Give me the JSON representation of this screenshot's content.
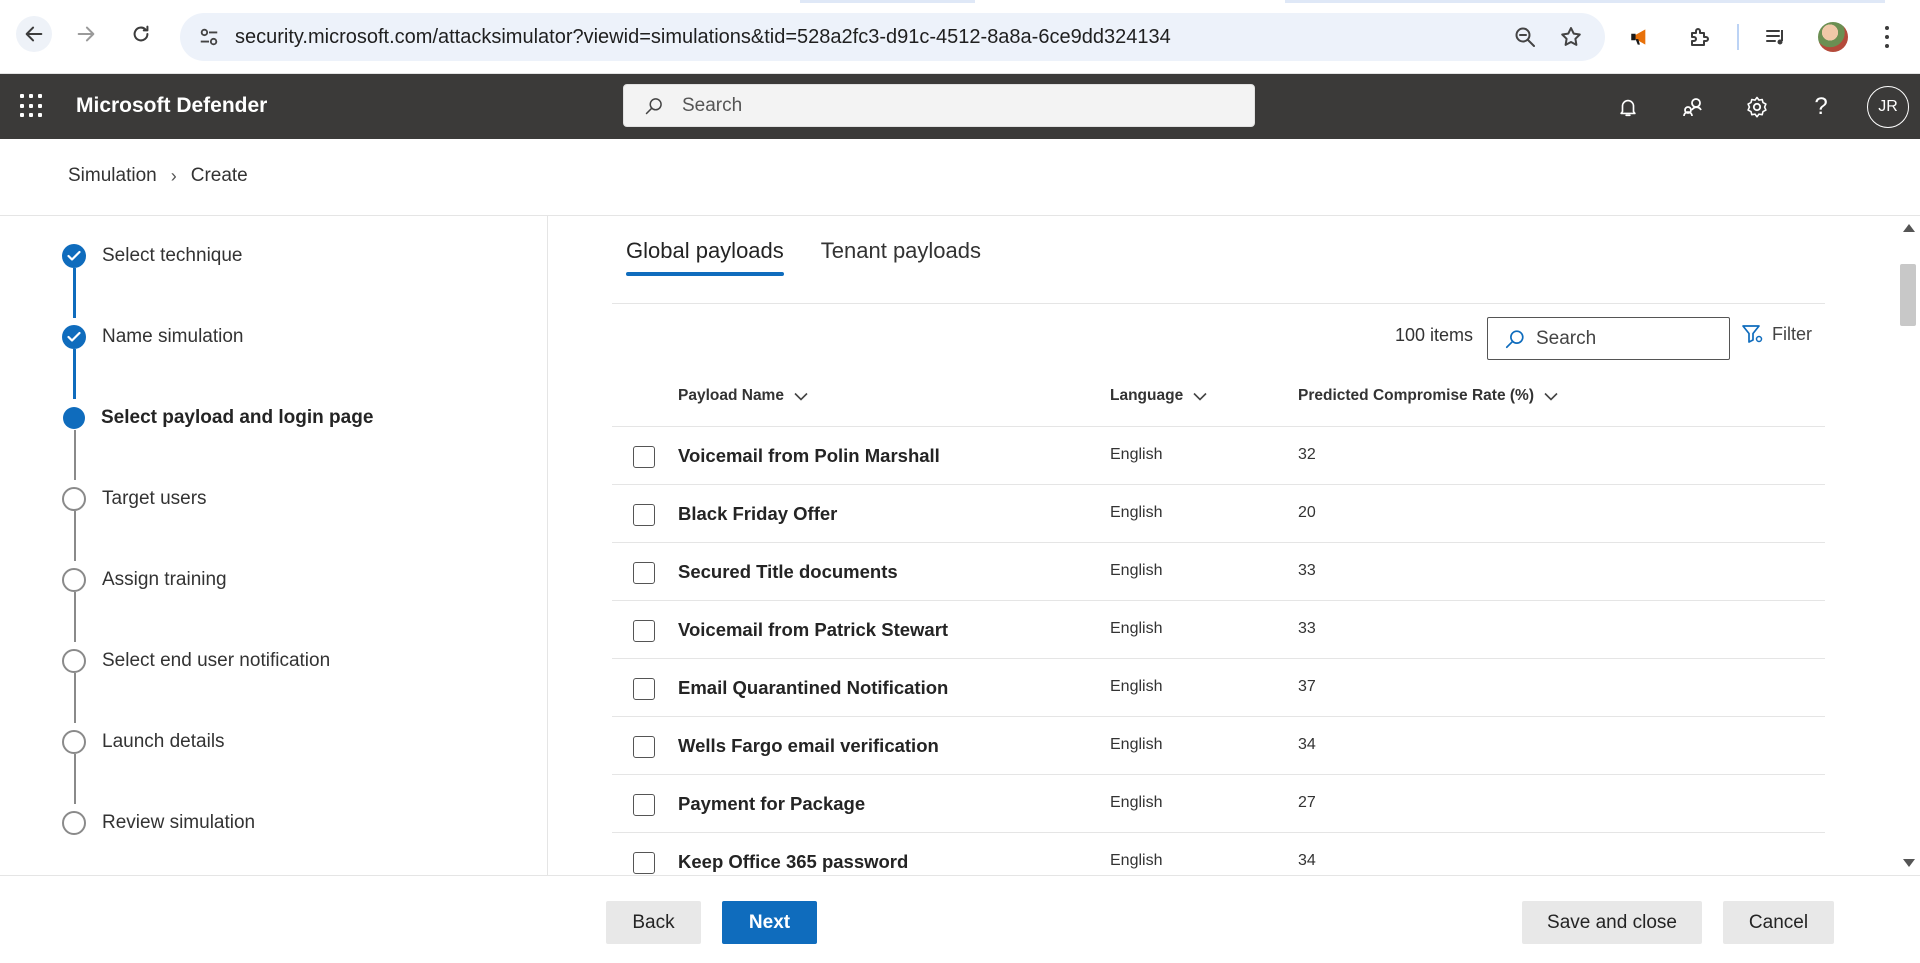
{
  "browser": {
    "url": "security.microsoft.com/attacksimulator?viewid=simulations&tid=528a2fc3-d91c-4512-8a8a-6ce9dd324134"
  },
  "app": {
    "title": "Microsoft Defender",
    "search_placeholder": "Search",
    "avatar_initials": "JR"
  },
  "breadcrumb": {
    "items": [
      "Simulation",
      "Create"
    ]
  },
  "wizard": {
    "steps": [
      {
        "label": "Select technique",
        "state": "done"
      },
      {
        "label": "Name simulation",
        "state": "done"
      },
      {
        "label": "Select payload and login page",
        "state": "current"
      },
      {
        "label": "Target users",
        "state": "pending"
      },
      {
        "label": "Assign training",
        "state": "pending"
      },
      {
        "label": "Select end user notification",
        "state": "pending"
      },
      {
        "label": "Launch details",
        "state": "pending"
      },
      {
        "label": "Review simulation",
        "state": "pending"
      }
    ]
  },
  "tabs": [
    {
      "label": "Global payloads",
      "active": true
    },
    {
      "label": "Tenant payloads",
      "active": false
    }
  ],
  "toolbar": {
    "items_count": "100 items",
    "search_placeholder": "Search",
    "filter_label": "Filter"
  },
  "table": {
    "columns": [
      "Payload Name",
      "Language",
      "Predicted Compromise Rate (%)"
    ],
    "rows": [
      {
        "name": "Voicemail from Polin Marshall",
        "language": "English",
        "rate": "32"
      },
      {
        "name": "Black Friday Offer",
        "language": "English",
        "rate": "20"
      },
      {
        "name": "Secured Title documents",
        "language": "English",
        "rate": "33"
      },
      {
        "name": "Voicemail from Patrick Stewart",
        "language": "English",
        "rate": "33"
      },
      {
        "name": "Email Quarantined Notification",
        "language": "English",
        "rate": "37"
      },
      {
        "name": "Wells Fargo email verification",
        "language": "English",
        "rate": "34"
      },
      {
        "name": "Payment for Package",
        "language": "English",
        "rate": "27"
      },
      {
        "name": "Keep Office 365 password",
        "language": "English",
        "rate": "34"
      }
    ]
  },
  "footer": {
    "back_label": "Back",
    "next_label": "Next",
    "save_label": "Save and close",
    "cancel_label": "Cancel"
  },
  "colors": {
    "accent": "#0f6cbd",
    "header_bg": "#3b3a39"
  }
}
